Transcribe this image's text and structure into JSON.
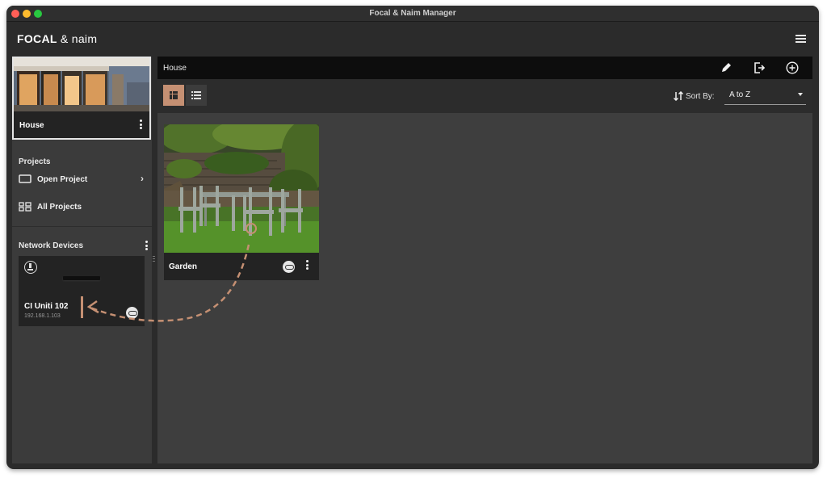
{
  "window": {
    "title": "Focal & Naim Manager"
  },
  "brand": {
    "part1": "FOCAL",
    "part2": " & naim"
  },
  "sidebar": {
    "current_project": "House",
    "projects_heading": "Projects",
    "open_project": "Open Project",
    "all_projects": "All Projects",
    "network_heading": "Network Devices",
    "device": {
      "name": "CI Uniti 102",
      "ip": "192.168.1.103"
    }
  },
  "main": {
    "title": "House",
    "sort_label": "Sort By:",
    "sort_value": "A to Z",
    "rooms": [
      {
        "name": "Garden"
      }
    ]
  },
  "colors": {
    "accent": "#c59073",
    "panel": "#3e3e3e",
    "bar": "#0d0d0d"
  },
  "icons": [
    "menu-icon",
    "pencil-icon",
    "exit-icon",
    "add-circle-icon",
    "grid-view-icon",
    "list-view-icon",
    "sort-icon",
    "monitor-icon",
    "all-projects-icon",
    "download-icon",
    "link-icon",
    "more-vertical-icon"
  ]
}
